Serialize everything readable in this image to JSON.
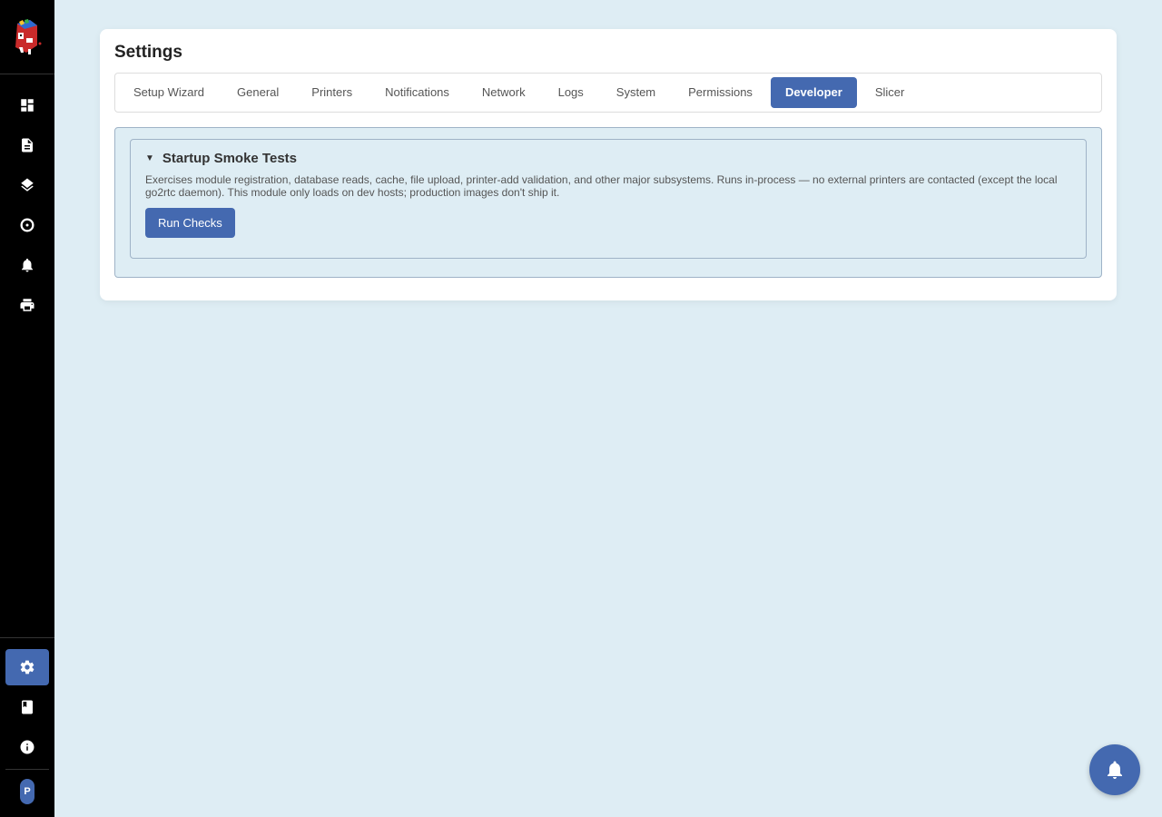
{
  "sidebar": {
    "logo_icon": "printer-mascot-logo",
    "top_items": [
      {
        "name": "dashboard",
        "icon": "dashboard-icon"
      },
      {
        "name": "files",
        "icon": "file-icon"
      },
      {
        "name": "layers",
        "icon": "layers-icon"
      },
      {
        "name": "spools",
        "icon": "spool-icon"
      },
      {
        "name": "notifications",
        "icon": "bell-icon"
      },
      {
        "name": "printers",
        "icon": "printer-icon"
      }
    ],
    "bottom_items": [
      {
        "name": "settings",
        "icon": "gear-icon",
        "active": true
      },
      {
        "name": "docs",
        "icon": "book-icon"
      },
      {
        "name": "about",
        "icon": "info-icon"
      }
    ],
    "avatar_initial": "P"
  },
  "page": {
    "title": "Settings"
  },
  "tabs": [
    {
      "label": "Setup Wizard",
      "active": false
    },
    {
      "label": "General",
      "active": false
    },
    {
      "label": "Printers",
      "active": false
    },
    {
      "label": "Notifications",
      "active": false
    },
    {
      "label": "Network",
      "active": false
    },
    {
      "label": "Logs",
      "active": false
    },
    {
      "label": "System",
      "active": false
    },
    {
      "label": "Permissions",
      "active": false
    },
    {
      "label": "Developer",
      "active": true
    },
    {
      "label": "Slicer",
      "active": false
    }
  ],
  "smoke_tests": {
    "caret": "▼",
    "title": "Startup Smoke Tests",
    "description": "Exercises module registration, database reads, cache, file upload, printer-add validation, and other major subsystems. Runs in-process — no external printers are contacted (except the local go2rtc daemon). This module only loads on dev hosts; production images don't ship it.",
    "run_button": "Run Checks"
  },
  "fab": {
    "icon": "bell-icon"
  },
  "colors": {
    "accent": "#4469b0",
    "sidebar_bg": "#000000",
    "page_bg": "#deedf4"
  }
}
